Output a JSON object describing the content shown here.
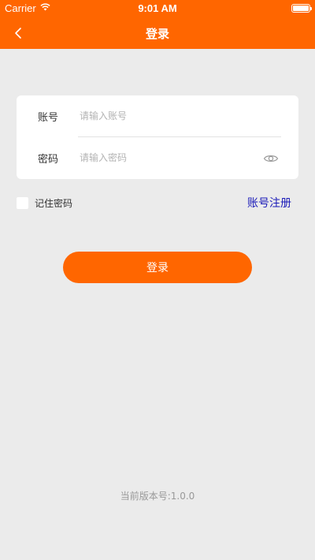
{
  "status_bar": {
    "carrier": "Carrier",
    "time": "9:01 AM",
    "wifi_icon": "wifi-icon",
    "battery_icon": "battery-icon"
  },
  "nav": {
    "title": "登录",
    "back_icon": "chevron-left-icon"
  },
  "form": {
    "account": {
      "label": "账号",
      "placeholder": "请输入账号",
      "value": ""
    },
    "password": {
      "label": "密码",
      "placeholder": "请输入密码",
      "value": "",
      "toggle_icon": "eye-icon"
    }
  },
  "remember": {
    "label": "记住密码",
    "checked": false
  },
  "register_link": "账号注册",
  "login_button": "登录",
  "version": "当前版本号:1.0.0",
  "colors": {
    "brand": "#ff6600",
    "background": "#ebebeb",
    "link": "#1a1ab8"
  }
}
